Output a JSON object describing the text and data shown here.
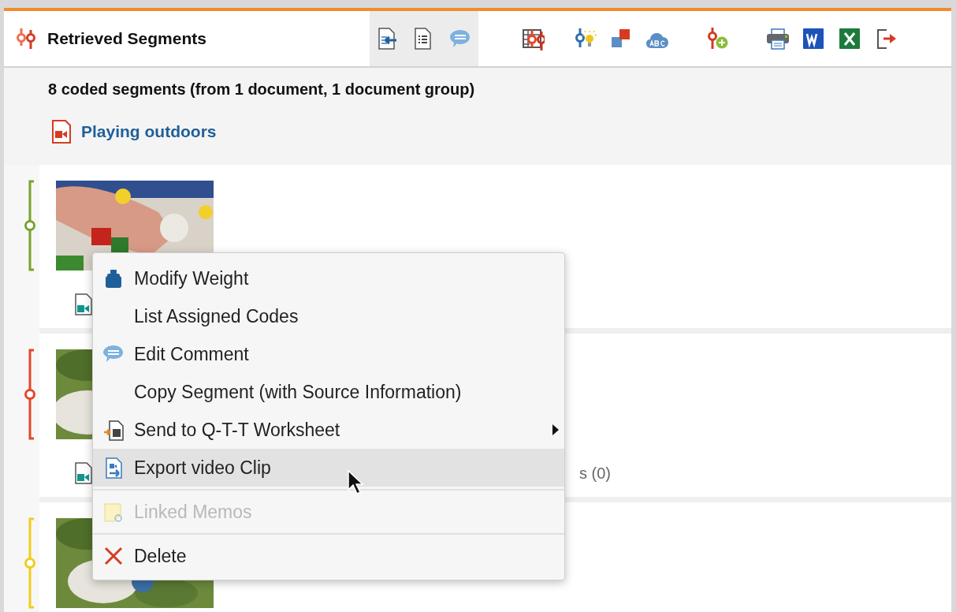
{
  "window": {
    "title": "Retrieved Segments"
  },
  "summary": "8 coded segments (from 1 document, 1 document group)",
  "document": {
    "name": "Playing outdoors"
  },
  "segments": [
    {
      "color": "#78a22f"
    },
    {
      "color": "#e2462a",
      "info": "s (0)"
    },
    {
      "color": "#f1cd1a"
    }
  ],
  "context_menu": {
    "items": [
      {
        "kind": "item",
        "label": "Modify Weight",
        "selected": false,
        "disabled": false,
        "submenu": false
      },
      {
        "kind": "item",
        "label": "List Assigned Codes",
        "selected": false,
        "disabled": false,
        "submenu": false
      },
      {
        "kind": "item",
        "label": "Edit Comment",
        "selected": false,
        "disabled": false,
        "submenu": false
      },
      {
        "kind": "item",
        "label": "Copy Segment (with Source Information)",
        "selected": false,
        "disabled": false,
        "submenu": false
      },
      {
        "kind": "item",
        "label": "Send to Q-T-T Worksheet",
        "selected": false,
        "disabled": false,
        "submenu": true
      },
      {
        "kind": "item",
        "label": "Export video Clip",
        "selected": true,
        "disabled": false,
        "submenu": false
      },
      {
        "kind": "separator"
      },
      {
        "kind": "item",
        "label": "Linked Memos",
        "selected": false,
        "disabled": true,
        "submenu": false
      },
      {
        "kind": "separator"
      },
      {
        "kind": "item",
        "label": "Delete",
        "selected": false,
        "disabled": false,
        "submenu": false
      }
    ]
  }
}
